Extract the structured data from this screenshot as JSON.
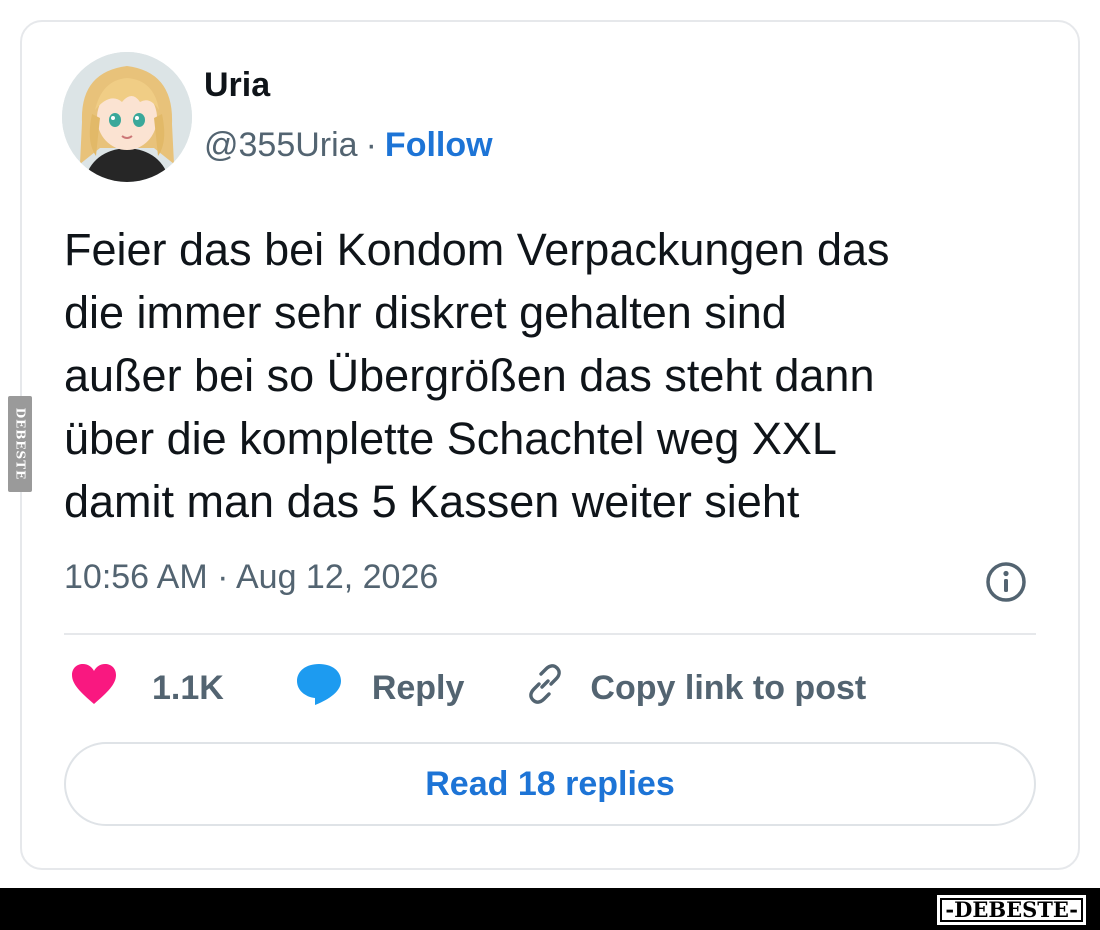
{
  "post": {
    "display_name": "Uria",
    "handle": "@355Uria",
    "separator": "·",
    "follow_label": "Follow",
    "avatar_icon": "anime-avatar-blonde-girl",
    "text_lines": [
      "Feier das bei Kondom Verpackungen das",
      "die immer sehr diskret gehalten sind",
      "außer bei so Übergrößen das steht dann",
      "über die komplette Schachtel weg XXL",
      "damit man das 5 Kassen weiter sieht"
    ],
    "timestamp": "10:56 AM · Aug 12, 2026",
    "info_icon": "info-icon"
  },
  "actions": {
    "like_icon": "heart-icon",
    "like_color": "#f91880",
    "like_count": "1.1K",
    "reply_icon": "speech-bubble-icon",
    "reply_color": "#1d9bf0",
    "reply_label": "Reply",
    "copy_icon": "link-icon",
    "copy_label": "Copy link to post"
  },
  "read_replies_label": "Read 18 replies",
  "accent_color": "#1d74d6",
  "watermark": {
    "side_text": "DEBESTE",
    "brand_text": "-DEBESTE-"
  }
}
